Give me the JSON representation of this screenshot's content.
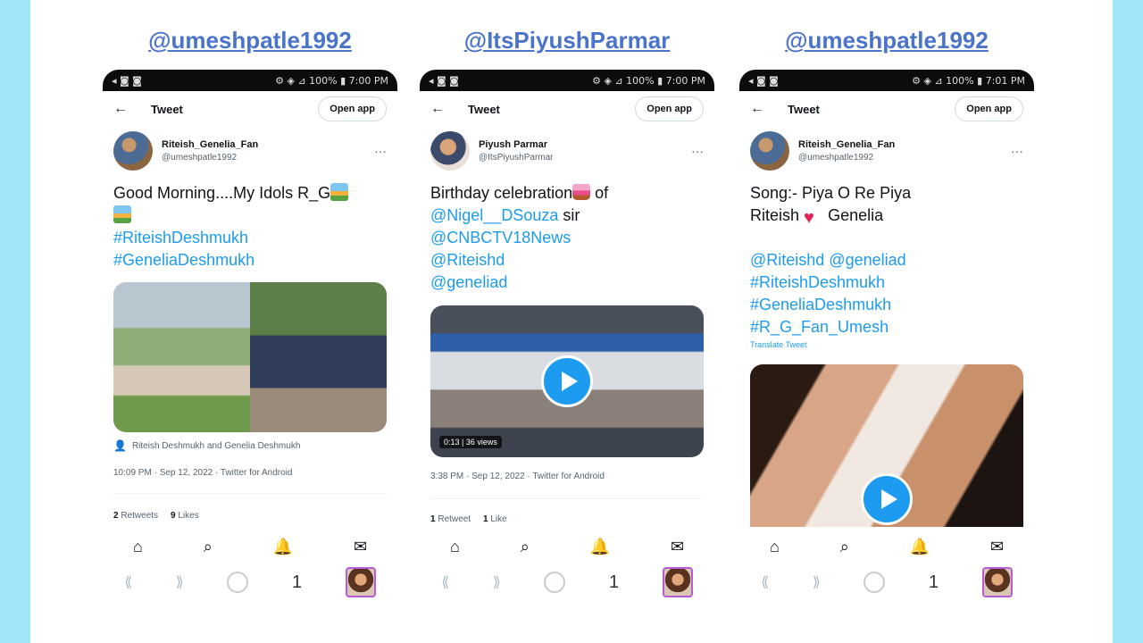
{
  "panels": [
    {
      "handle": "@umeshpatle1992",
      "status_left": "◂ ◙ ◙",
      "status_right": "⚙ ◈ ⊿ 100% ▮ 7:00 PM",
      "topbar_title": "Tweet",
      "open_app": "Open app",
      "author_name": "Riteish_Genelia_Fan",
      "author_handle": "@umeshpatle1992",
      "lines": [
        {
          "text": "Good Morning....My Idols R_G",
          "emoji": "sunrise",
          "type": "text"
        },
        {
          "text": "",
          "emoji": "sunrise",
          "type": "text"
        },
        {
          "text": "#RiteishDeshmukh",
          "type": "link"
        },
        {
          "text": "#GeneliaDeshmukh",
          "type": "link"
        }
      ],
      "tagline": "Riteish Deshmukh and Genelia Deshmukh",
      "meta": "10:09 PM · Sep 12, 2022 · Twitter for Android",
      "retweets": "2",
      "retweets_label": "Retweets",
      "likes": "9",
      "likes_label": "Likes"
    },
    {
      "handle": "@ItsPiyushParmar",
      "status_left": "◂ ◙ ◙",
      "status_right": "⚙ ◈ ⊿ 100% ▮ 7:00 PM",
      "topbar_title": "Tweet",
      "open_app": "Open app",
      "author_name": "Piyush Parmar",
      "author_handle": "@ItsPiyushParmar",
      "lines": [
        {
          "text": "Birthday celebration",
          "emoji_after": "cake",
          "suffix": " of",
          "type": "text"
        },
        {
          "text": "@Nigel__DSouza",
          "suffix": " sir",
          "type": "link"
        },
        {
          "text": "@CNBCTV18News",
          "type": "link"
        },
        {
          "text": "@Riteishd",
          "type": "link"
        },
        {
          "text": "@geneliad",
          "type": "link"
        }
      ],
      "video_badge": "0:13 | 36 views",
      "meta": "3:38 PM · Sep 12, 2022 · Twitter for Android",
      "retweets": "1",
      "retweets_label": "Retweet",
      "likes": "1",
      "likes_label": "Like"
    },
    {
      "handle": "@umeshpatle1992",
      "status_left": "◂ ◙ ◙",
      "status_right": "⚙ ◈ ⊿ 100% ▮ 7:01 PM",
      "topbar_title": "Tweet",
      "open_app": "Open app",
      "author_name": "Riteish_Genelia_Fan",
      "author_handle": "@umeshpatle1992",
      "song_line": "Song:- Piya O Re Piya",
      "names_left": "Riteish",
      "names_right": "Genelia",
      "link_lines": [
        "@Riteishd @geneliad",
        "#RiteishDeshmukh",
        "#GeneliaDeshmukh",
        "#R_G_Fan_Umesh"
      ],
      "translate": "Translate Tweet"
    }
  ],
  "navbar": {
    "home_icon": "⌂",
    "search_icon": "⌕",
    "bell_icon": "🔔",
    "mail_icon": "✉"
  },
  "browserbar": {
    "back_icon": "⟪",
    "forward_icon": "⟫",
    "tab_count": "1"
  },
  "colors": {
    "side_bar": "#9ee6f8",
    "handle": "#4a74c9",
    "link": "#1d9bf0"
  }
}
